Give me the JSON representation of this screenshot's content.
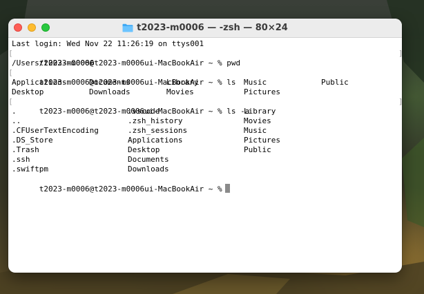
{
  "window": {
    "title": "t2023-m0006 — -zsh — 80×24",
    "folder_icon": "folder-icon",
    "colors": {
      "close": "#fe5f57",
      "minimize": "#febc2e",
      "maximize": "#28c840"
    }
  },
  "terminal": {
    "last_login": "Last login: Wed Nov 22 11:26:19 on ttys001",
    "prompt": "t2023-m0006@t2023-m0006ui-MacBookAir ~ %",
    "cmd1": "pwd",
    "pwd_output": "/Users/t2023-m0006",
    "cmd2": "ls",
    "ls_row1": [
      "Applications",
      "Documents",
      "Library",
      "Music",
      "Public"
    ],
    "ls_row2": [
      "Desktop",
      "Downloads",
      "Movies",
      "Pictures"
    ],
    "cmd3": "ls -a",
    "lsa_rows": [
      [
        ".",
        ".vscode",
        "Library"
      ],
      [
        "..",
        ".zsh_history",
        "Movies"
      ],
      [
        ".CFUserTextEncoding",
        ".zsh_sessions",
        "Music"
      ],
      [
        ".DS_Store",
        "Applications",
        "Pictures"
      ],
      [
        ".Trash",
        "Desktop",
        "Public"
      ],
      [
        ".ssh",
        "Documents",
        ""
      ],
      [
        ".swiftpm",
        "Downloads",
        ""
      ]
    ],
    "bracket_left": "[",
    "bracket_right": "]"
  }
}
